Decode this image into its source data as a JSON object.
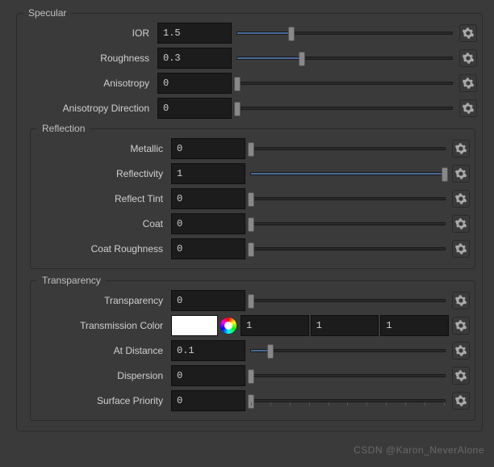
{
  "specular": {
    "legend": "Specular",
    "rows": [
      {
        "id": "ior",
        "label": "IOR",
        "value": "1.5",
        "pct": 25
      },
      {
        "id": "roughness",
        "label": "Roughness",
        "value": "0.3",
        "pct": 30
      },
      {
        "id": "anisotropy",
        "label": "Anisotropy",
        "value": "0",
        "pct": 0
      },
      {
        "id": "anisotropy-direction",
        "label": "Anisotropy Direction",
        "value": "0",
        "pct": 0
      }
    ]
  },
  "reflection": {
    "legend": "Reflection",
    "rows": [
      {
        "id": "metallic",
        "label": "Metallic",
        "value": "0",
        "pct": 0
      },
      {
        "id": "reflectivity",
        "label": "Reflectivity",
        "value": "1",
        "pct": 100
      },
      {
        "id": "reflect-tint",
        "label": "Reflect Tint",
        "value": "0",
        "pct": 0
      },
      {
        "id": "coat",
        "label": "Coat",
        "value": "0",
        "pct": 0
      },
      {
        "id": "coat-roughness",
        "label": "Coat Roughness",
        "value": "0",
        "pct": 0
      }
    ]
  },
  "transparency": {
    "legend": "Transparency",
    "rows_top": [
      {
        "id": "transparency",
        "label": "Transparency",
        "value": "0",
        "pct": 0
      }
    ],
    "color_row": {
      "id": "transmission-color",
      "label": "Transmission Color",
      "swatch": "#ffffff",
      "r": "1",
      "g": "1",
      "b": "1"
    },
    "rows_bottom": [
      {
        "id": "at-distance",
        "label": "At Distance",
        "value": "0.1",
        "pct": 10
      },
      {
        "id": "dispersion",
        "label": "Dispersion",
        "value": "0",
        "pct": 0
      },
      {
        "id": "surface-priority",
        "label": "Surface Priority",
        "value": "0",
        "pct": 0
      }
    ]
  },
  "watermark": "CSDN @Karon_NeverAlone"
}
